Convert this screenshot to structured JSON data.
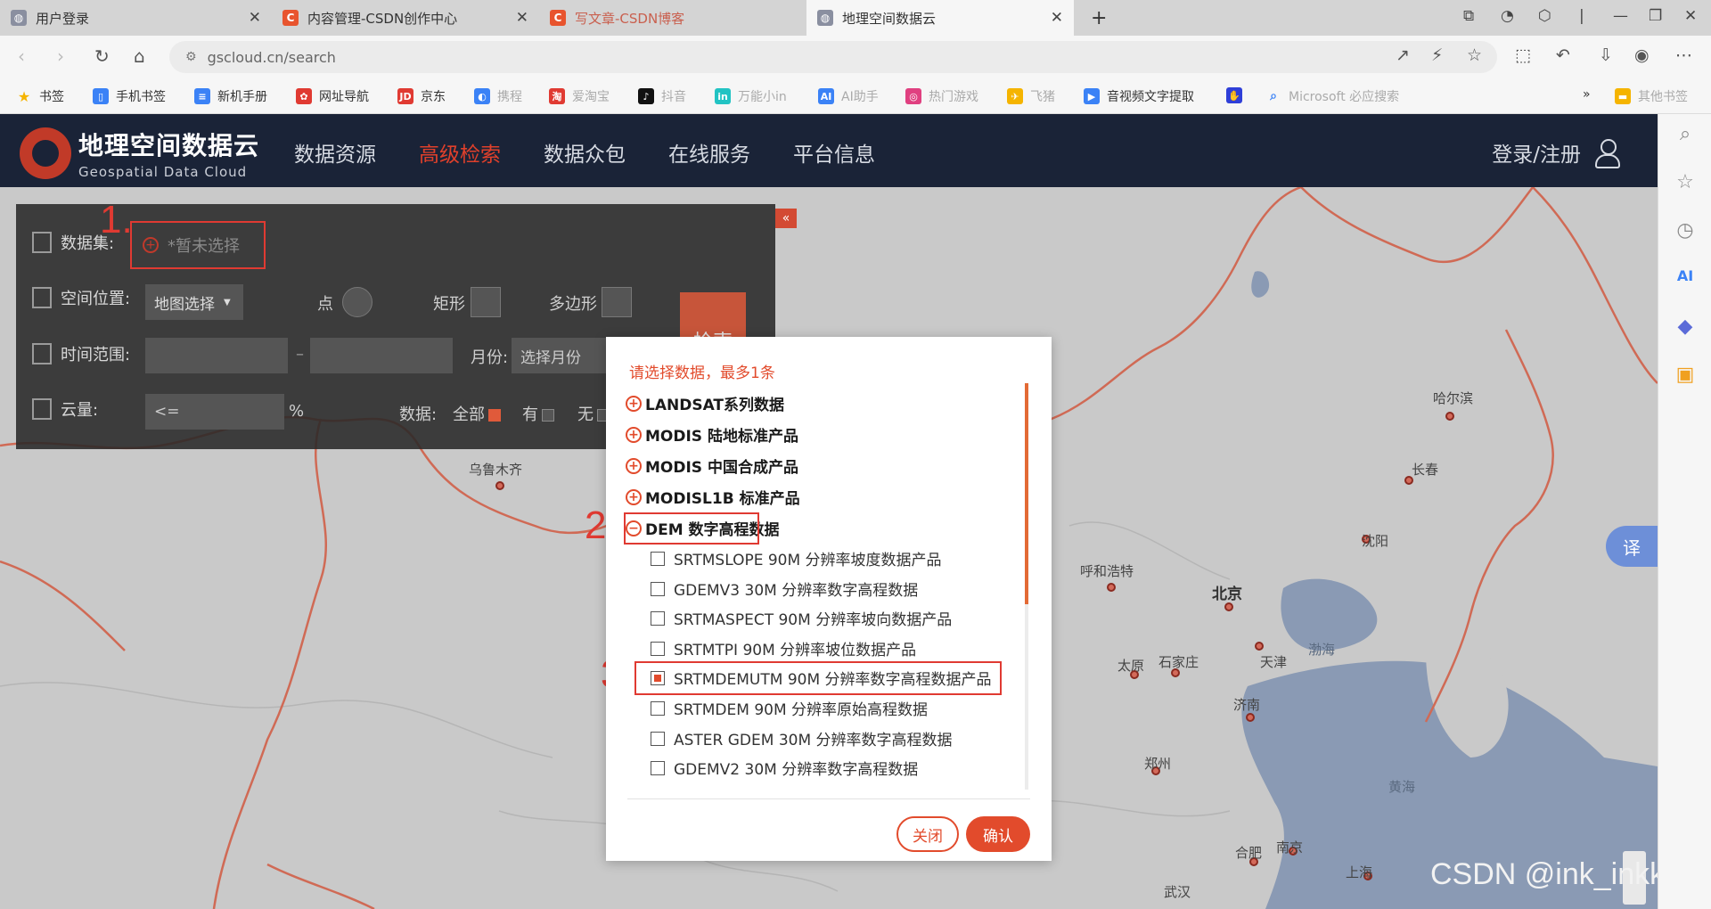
{
  "browser": {
    "tabs": [
      {
        "title": "用户登录",
        "favicon": "globe-icon",
        "state": "inactive"
      },
      {
        "title": "内容管理-CSDN创作中心",
        "favicon": "csdn-icon",
        "state": "inactive"
      },
      {
        "title": "写文章-CSDN博客",
        "favicon": "csdn-icon",
        "state": "loading"
      },
      {
        "title": "地理空间数据云",
        "favicon": "globe-icon",
        "state": "active"
      }
    ],
    "new_tab": "+",
    "url": "gscloud.cn/search",
    "bookmarks": [
      {
        "label": "书签",
        "icon": "star-icon",
        "color": "#f5b400"
      },
      {
        "label": "手机书签",
        "icon": "phone-icon",
        "color": "#3b82f6"
      },
      {
        "label": "新机手册",
        "icon": "book-icon",
        "color": "#3b82f6"
      },
      {
        "label": "网址导航",
        "icon": "nav-icon",
        "color": "#e03a32"
      },
      {
        "label": "京东",
        "icon": "jd-icon",
        "color": "#e03a32"
      },
      {
        "label": "携程",
        "icon": "ctrip-icon",
        "color": "#3b82f6"
      },
      {
        "label": "爱淘宝",
        "icon": "taobao-icon",
        "color": "#e03a32"
      },
      {
        "label": "抖音",
        "icon": "douyin-icon",
        "color": "#111111"
      },
      {
        "label": "万能小in",
        "icon": "xiaoin-icon",
        "color": "#22c3c3"
      },
      {
        "label": "AI助手",
        "icon": "ai-icon",
        "color": "#3b82f6"
      },
      {
        "label": "热门游戏",
        "icon": "game-icon",
        "color": "#e04080"
      },
      {
        "label": "飞猪",
        "icon": "fliggy-icon",
        "color": "#f5b400"
      },
      {
        "label": "音视频文字提取",
        "icon": "media-icon",
        "color": "#3b82f6"
      },
      {
        "label": "",
        "icon": "baidu-icon",
        "color": "#2f3fd8"
      },
      {
        "label": "Microsoft 必应搜索",
        "icon": "search-icon",
        "color": "#3b82f6"
      }
    ],
    "other_bookmarks": "其他书签",
    "more_bookmarks": "»"
  },
  "site": {
    "logo_cn": "地理空间数据云",
    "logo_en": "Geospatial Data Cloud",
    "nav": [
      "数据资源",
      "高级检索",
      "数据众包",
      "在线服务",
      "平台信息"
    ],
    "active_nav": "高级检索",
    "login": "登录/注册"
  },
  "search_panel": {
    "collapse": "«",
    "dataset_label": "数据集:",
    "dataset_placeholder": "*暂未选择",
    "location_label": "空间位置:",
    "location_select": "地图选择",
    "point_label": "点",
    "rect_label": "矩形",
    "polygon_label": "多边形",
    "time_label": "时间范围:",
    "time_sep": "–",
    "month_label": "月份:",
    "month_placeholder": "选择月份",
    "cloud_label": "云量:",
    "cloud_value": "<=",
    "cloud_unit": "%",
    "data_label": "数据:",
    "data_all": "全部",
    "data_yes": "有",
    "data_no": "无",
    "search_button": "检索"
  },
  "annotations": [
    "1.",
    "2.",
    "3."
  ],
  "dialog": {
    "hint": "请选择数据，最多1条",
    "categories": [
      {
        "label": "LANDSAT系列数据",
        "expanded": false
      },
      {
        "label": "MODIS 陆地标准产品",
        "expanded": false
      },
      {
        "label": "MODIS 中国合成产品",
        "expanded": false
      },
      {
        "label": "MODISL1B 标准产品",
        "expanded": false
      },
      {
        "label": "DEM 数字高程数据",
        "expanded": true
      }
    ],
    "dem_items": [
      {
        "label": "SRTMSLOPE 90M 分辨率坡度数据产品",
        "checked": false
      },
      {
        "label": "GDEMV3 30M 分辨率数字高程数据",
        "checked": false
      },
      {
        "label": "SRTMASPECT 90M 分辨率坡向数据产品",
        "checked": false
      },
      {
        "label": "SRTMTPI 90M 分辨率坡位数据产品",
        "checked": false
      },
      {
        "label": "SRTMDEMUTM 90M 分辨率数字高程数据产品",
        "checked": true
      },
      {
        "label": "SRTMDEM 90M 分辨率原始高程数据",
        "checked": false
      },
      {
        "label": "ASTER GDEM 30M 分辨率数字高程数据",
        "checked": false
      },
      {
        "label": "GDEMV2 30M 分辨率数字高程数据",
        "checked": false
      }
    ],
    "close_button": "关闭",
    "ok_button": "确认"
  },
  "map": {
    "cities": [
      "乌鲁木齐",
      "哈尔滨",
      "长春",
      "沈阳",
      "呼和浩特",
      "北京",
      "天津",
      "太原",
      "石家庄",
      "济南",
      "郑州",
      "合肥",
      "南京",
      "上海",
      "武汉"
    ],
    "seas": [
      "渤海",
      "黄海"
    ]
  },
  "translate": "译",
  "watermark": "CSDN @ink_inkkkk",
  "colors": {
    "accent": "#e24b2c",
    "header_bg": "#1a2337",
    "map_bg": "#c9c9c9",
    "sea": "#8a9ab4"
  }
}
